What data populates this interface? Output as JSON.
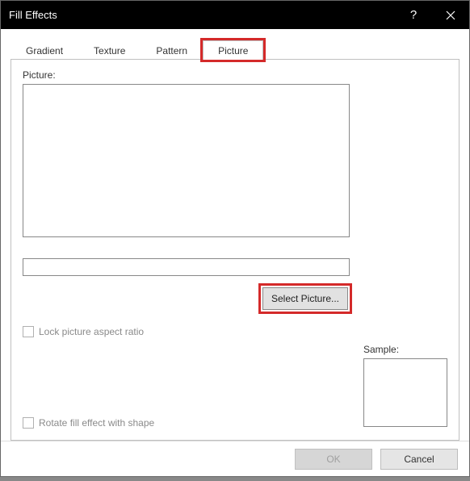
{
  "dialog": {
    "title": "Fill Effects",
    "help_icon": "?",
    "close_icon": "✕"
  },
  "tabs": {
    "items": [
      {
        "label": "Gradient"
      },
      {
        "label": "Texture"
      },
      {
        "label": "Pattern"
      },
      {
        "label": "Picture"
      }
    ],
    "active_index": 3,
    "highlighted_index": 3
  },
  "picture_panel": {
    "label": "Picture:",
    "name_value": "",
    "select_button": "Select Picture...",
    "lock_aspect_label": "Lock picture aspect ratio",
    "lock_aspect_checked": false,
    "rotate_label": "Rotate fill effect with shape",
    "rotate_checked": false,
    "sample_label": "Sample:"
  },
  "footer": {
    "ok_label": "OK",
    "ok_enabled": false,
    "cancel_label": "Cancel"
  },
  "highlights": {
    "tab_picture": true,
    "select_picture_button": true
  },
  "colors": {
    "highlight": "#d42a2a",
    "titlebar_bg": "#000000",
    "titlebar_fg": "#ffffff"
  }
}
